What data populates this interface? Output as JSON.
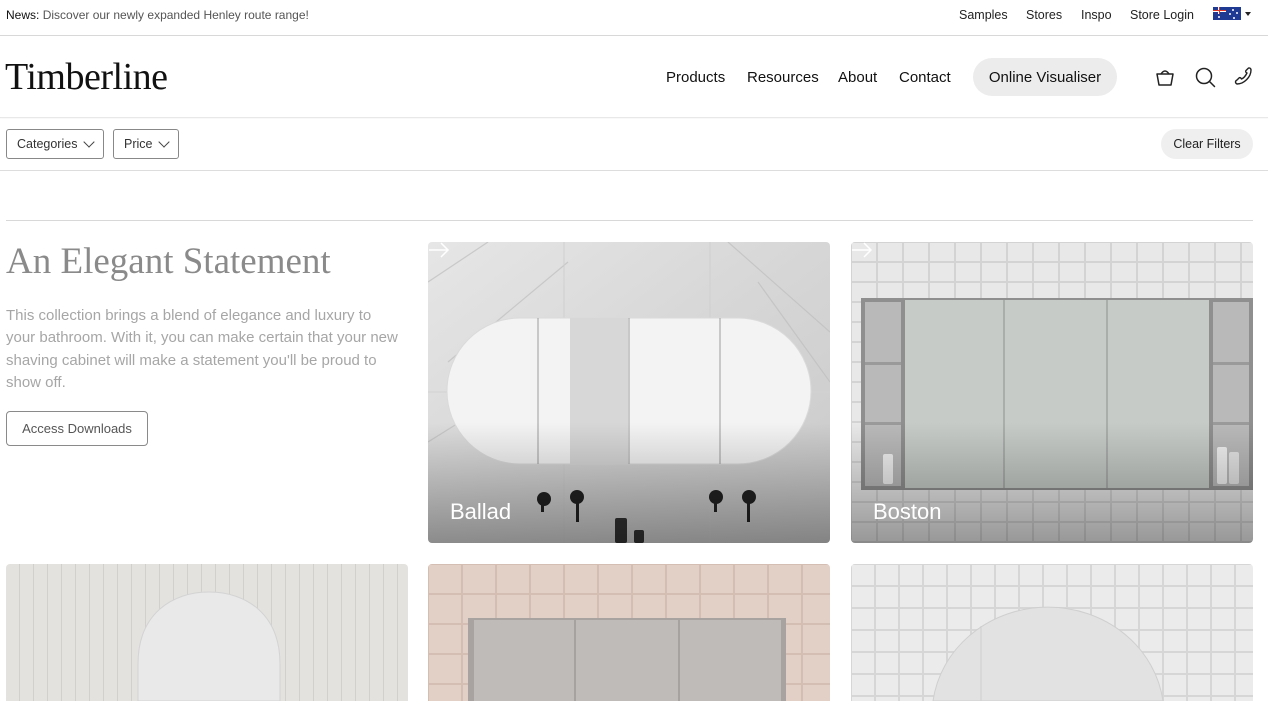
{
  "announcement": {
    "label": "News:",
    "text": "Discover our newly expanded Henley route range!"
  },
  "utility_nav": [
    "Samples",
    "Stores",
    "Inspo",
    "Store Login"
  ],
  "locale": {
    "icon": "australia-flag-icon"
  },
  "header": {
    "logo": "Timberline",
    "nav": [
      "Products",
      "Resources",
      "About",
      "Contact"
    ],
    "cta": "Online Visualiser",
    "icons": [
      "basket-icon",
      "search-icon",
      "phone-icon"
    ]
  },
  "filters": {
    "categories": "Categories",
    "price": "Price",
    "clear": "Clear Filters"
  },
  "intro": {
    "title": "An Elegant Statement",
    "text": "This collection brings a blend of elegance and luxury to your bathroom. With it, you can make certain that your new shaving cabinet will make a statement you'll be proud to show off.",
    "button": "Access Downloads"
  },
  "products": [
    {
      "name": "Ballad"
    },
    {
      "name": "Boston"
    },
    {
      "name": ""
    },
    {
      "name": ""
    },
    {
      "name": ""
    }
  ]
}
